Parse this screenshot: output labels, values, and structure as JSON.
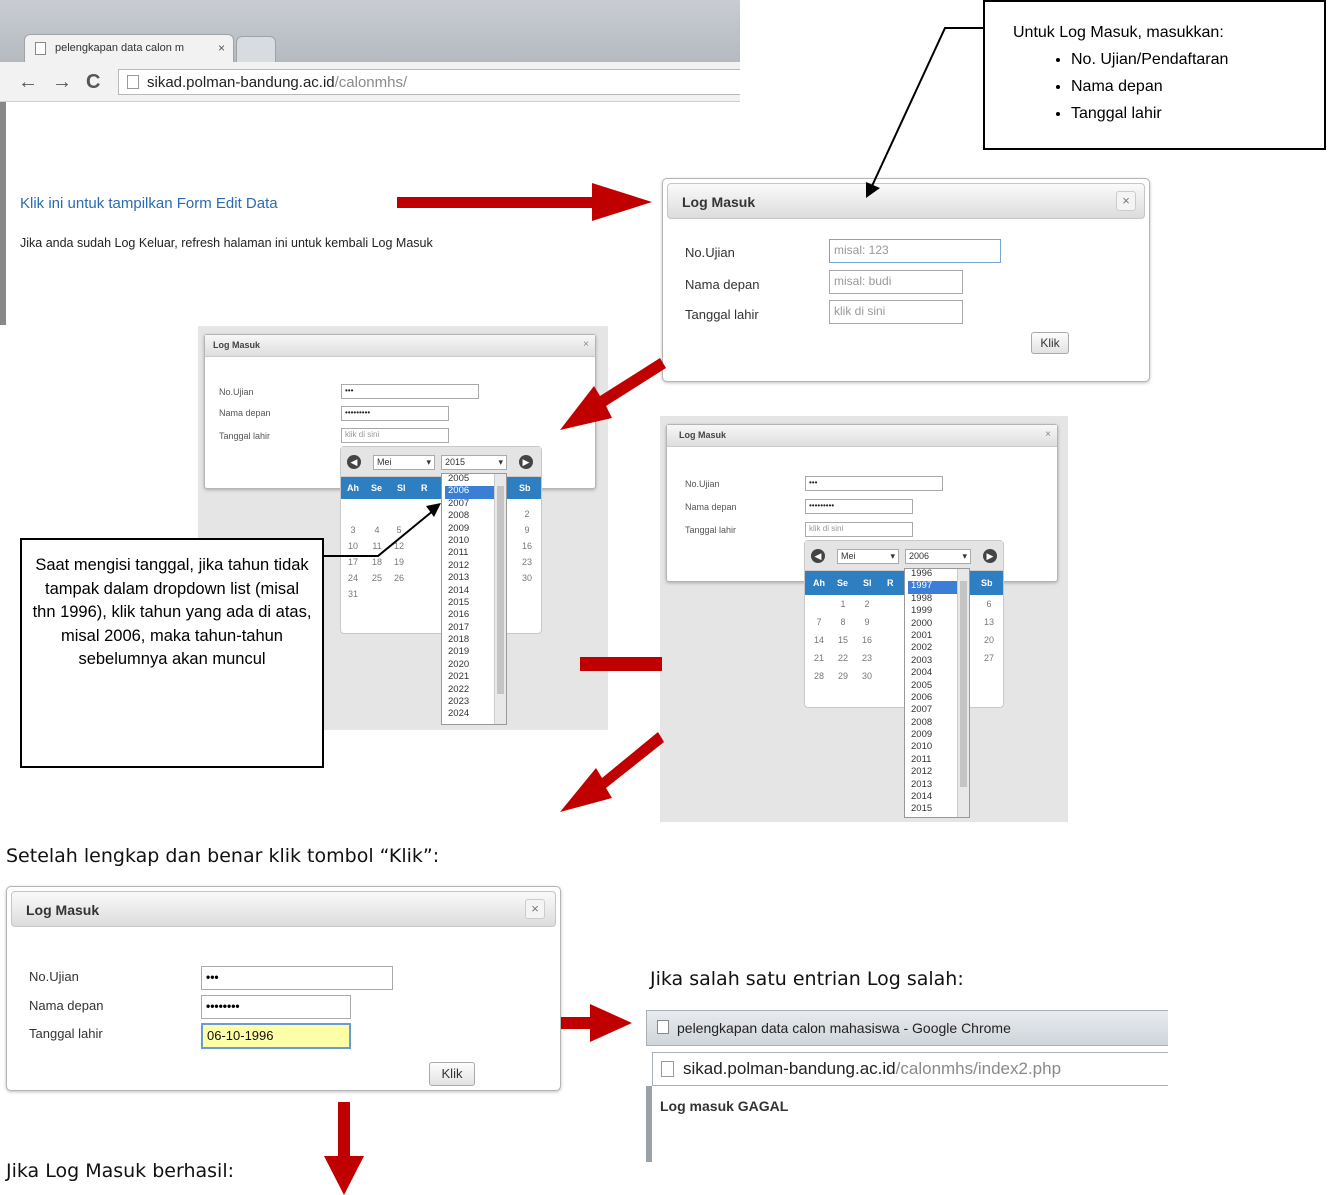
{
  "browser_top": {
    "tab_title": "pelengkapan data calon m",
    "tab_close": "×",
    "url_host": "sikad.polman-bandung.ac.id",
    "url_path": "/calonmhs/",
    "link_text": "Klik ini untuk tampilkan Form Edit Data",
    "info_text": "Jika anda sudah Log Keluar, refresh halaman ini untuk kembali Log Masuk"
  },
  "callout_login": {
    "title": "Untuk Log Masuk, masukkan:",
    "items": [
      "No. Ujian/Pendaftaran",
      "Nama depan",
      "Tanggal lahir"
    ]
  },
  "callout_year": {
    "text": "Saat mengisi tanggal, jika tahun tidak tampak dalam dropdown list (misal thn 1996), klik tahun yang ada di atas, misal 2006, maka tahun-tahun sebelumnya akan muncul"
  },
  "dialog_empty": {
    "title": "Log Masuk",
    "close": "×",
    "label_noujian": "No.Ujian",
    "label_nama": "Nama depan",
    "label_tanggal": "Tanggal lahir",
    "ph_noujian": "misal: 123",
    "ph_nama": "misal: budi",
    "ph_tanggal": "klik di sini",
    "button": "Klik"
  },
  "screen2": {
    "title": "Log Masuk",
    "close": "×",
    "label_noujian": "No.Ujian",
    "label_nama": "Nama depan",
    "label_tanggal": "Tanggal lahir",
    "val_noujian": "•••",
    "val_nama": "•••••••••",
    "ph_tanggal": "klik di sini",
    "month": "Mei",
    "year": "2015",
    "day_headers": [
      "Ah",
      "Se",
      "Sl",
      "R",
      "Sb"
    ],
    "years": [
      "2005",
      "2006",
      "2007",
      "2008",
      "2009",
      "2010",
      "2011",
      "2012",
      "2013",
      "2014",
      "2015",
      "2016",
      "2017",
      "2018",
      "2019",
      "2020",
      "2021",
      "2022",
      "2023",
      "2024"
    ],
    "highlight_year": "2006",
    "cells_left": [
      "3",
      "10",
      "17",
      "24",
      "31"
    ],
    "cells_mid1": [
      "4",
      "11",
      "18",
      "25"
    ],
    "cells_mid2": [
      "5",
      "12",
      "19",
      "26"
    ],
    "cells_right": [
      "2",
      "9",
      "16",
      "23",
      "30"
    ]
  },
  "screen3": {
    "title": "Log Masuk",
    "close": "×",
    "label_noujian": "No.Ujian",
    "label_nama": "Nama depan",
    "label_tanggal": "Tanggal lahir",
    "val_noujian": "•••",
    "val_nama": "•••••••••",
    "ph_tanggal": "klik di sini",
    "month": "Mei",
    "year": "2006",
    "day_headers": [
      "Ah",
      "Se",
      "Sl",
      "R",
      "Sb"
    ],
    "years": [
      "1996",
      "1997",
      "1998",
      "1999",
      "2000",
      "2001",
      "2002",
      "2003",
      "2004",
      "2005",
      "2006",
      "2007",
      "2008",
      "2009",
      "2010",
      "2011",
      "2012",
      "2013",
      "2014",
      "2015"
    ],
    "highlight_year": "1997",
    "cells_left": [
      "7",
      "14",
      "21",
      "28"
    ],
    "cells_mid1": [
      "1",
      "8",
      "15",
      "22",
      "29"
    ],
    "cells_mid2": [
      "2",
      "9",
      "16",
      "23",
      "30"
    ],
    "cells_right": [
      "6",
      "13",
      "20",
      "27"
    ]
  },
  "caption_after": "Setelah lengkap dan benar klik tombol “Klik”:",
  "dialog_filled": {
    "title": "Log Masuk",
    "close": "×",
    "label_noujian": "No.Ujian",
    "label_nama": "Nama depan",
    "label_tanggal": "Tanggal lahir",
    "val_noujian": "•••",
    "val_nama": "••••••••",
    "val_tanggal": "06-10-1996",
    "button": "Klik"
  },
  "caption_wrong": "Jika salah satu entrian Log salah:",
  "error_window": {
    "title": "pelengkapan data calon mahasiswa - Google Chrome",
    "url_host": "sikad.polman-bandung.ac.id",
    "url_path": "/calonmhs/index2.php",
    "message": "Log masuk GAGAL"
  },
  "caption_success": "Jika Log Masuk berhasil:",
  "colors": {
    "arrow": "#c00000",
    "link": "#2a6bb3",
    "calendar_header": "#2e7ec2",
    "highlight_input": "#ffffa8"
  }
}
